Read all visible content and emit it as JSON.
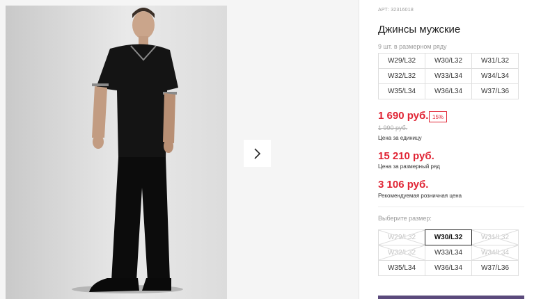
{
  "gallery": {
    "photo_alt": "",
    "next_icon": "chevron-right-icon"
  },
  "product": {
    "article": "АРТ: 32316018",
    "title": "Джинсы мужские",
    "pack_note": "9 шт. в размерном ряду",
    "pack_sizes": [
      "W29/L32",
      "W30/L32",
      "W31/L32",
      "W32/L32",
      "W33/L34",
      "W34/L34",
      "W35/L34",
      "W36/L34",
      "W37/L36"
    ]
  },
  "pricing": {
    "price": "1 690 руб.",
    "discount": "15%",
    "old_price": "1 990 руб.",
    "unit_label": "Цена за единицу",
    "pack_price": "15 210 руб.",
    "pack_label": "Цена за размерный ряд",
    "rrp_price": "3 106 руб.",
    "rrp_label": "Рекомендуемая розничная цена",
    "accent_color": "#e02434"
  },
  "size_picker": {
    "label": "Выберите размер:",
    "sizes": [
      {
        "label": "W29/L32",
        "state": "disabled"
      },
      {
        "label": "W30/L32",
        "state": "selected"
      },
      {
        "label": "W31/L32",
        "state": "disabled"
      },
      {
        "label": "W32/L32",
        "state": "disabled"
      },
      {
        "label": "W33/L34",
        "state": "available"
      },
      {
        "label": "W34/L34",
        "state": "disabled"
      },
      {
        "label": "W35/L34",
        "state": "available"
      },
      {
        "label": "W36/L34",
        "state": "available"
      },
      {
        "label": "W37/L36",
        "state": "available"
      }
    ]
  },
  "colors": {
    "buy_bar": "#5b4a7c"
  }
}
